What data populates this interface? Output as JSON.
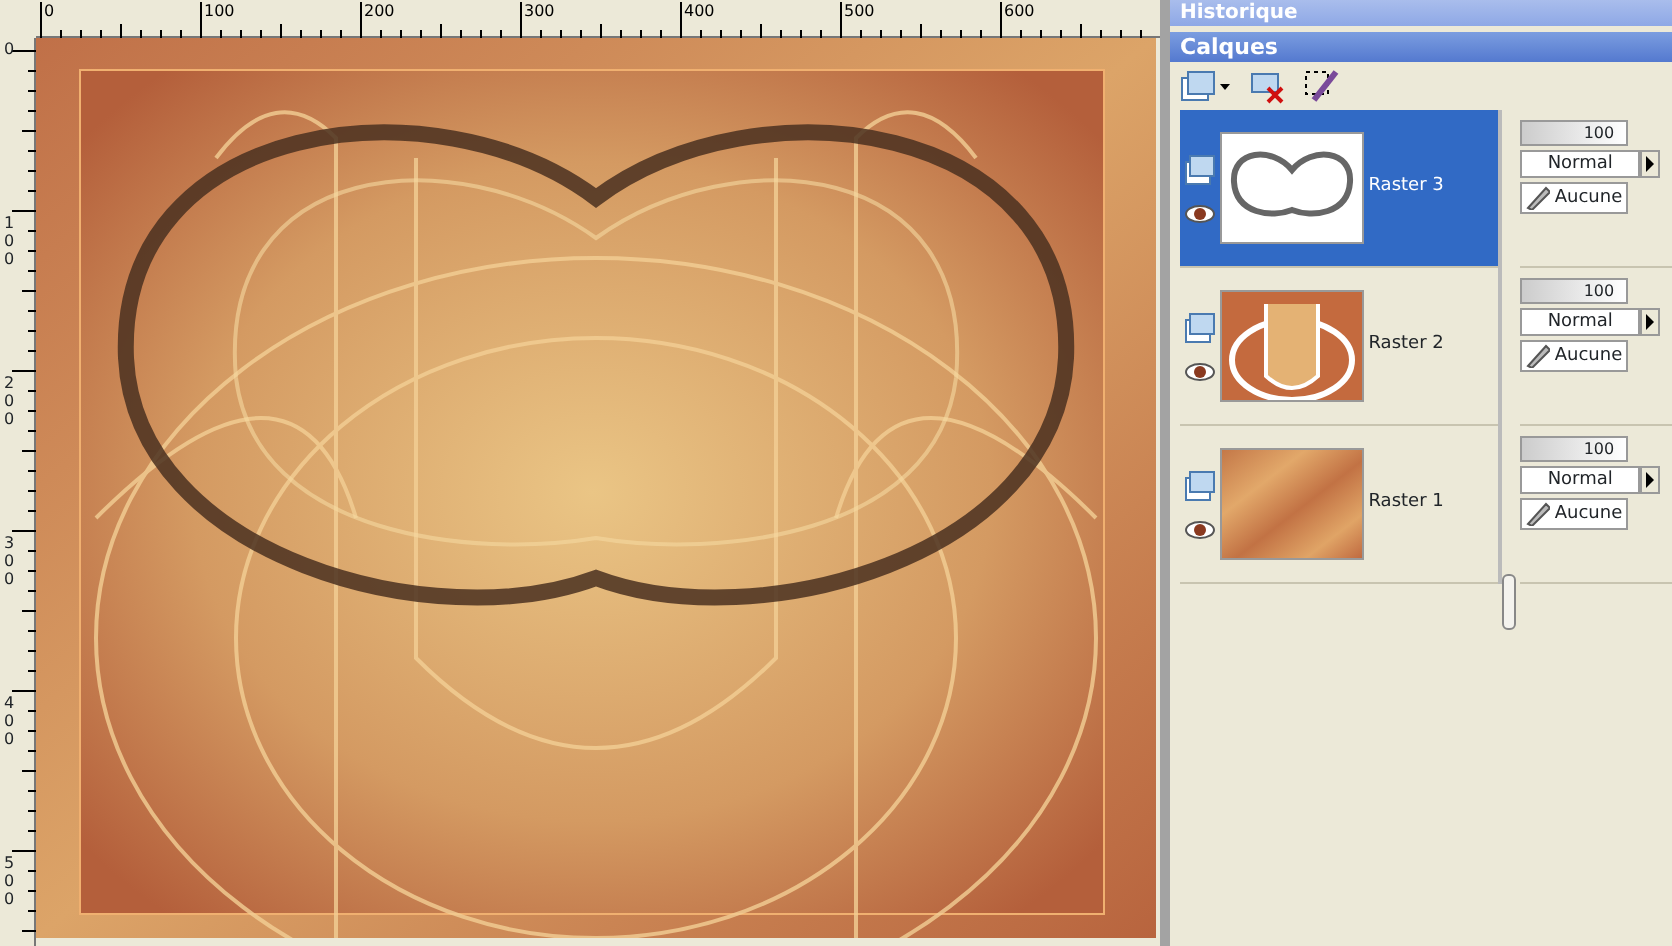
{
  "rulers": {
    "horizontal": [
      "0",
      "100",
      "200",
      "300",
      "400",
      "500",
      "600"
    ],
    "vertical": [
      "0",
      "100",
      "200",
      "300",
      "400",
      "500"
    ]
  },
  "history_palette": {
    "title": "Historique"
  },
  "layers_palette": {
    "title": "Calques",
    "layers": [
      {
        "name": "Raster 3",
        "selected": true,
        "visible": true,
        "kind": "outline",
        "opacity": "100",
        "blend_mode": "Normal",
        "mask": "Aucune"
      },
      {
        "name": "Raster 2",
        "selected": false,
        "visible": true,
        "kind": "frame",
        "opacity": "100",
        "blend_mode": "Normal",
        "mask": "Aucune"
      },
      {
        "name": "Raster 1",
        "selected": false,
        "visible": true,
        "kind": "gradient",
        "opacity": "100",
        "blend_mode": "Normal",
        "mask": "Aucune"
      }
    ]
  }
}
